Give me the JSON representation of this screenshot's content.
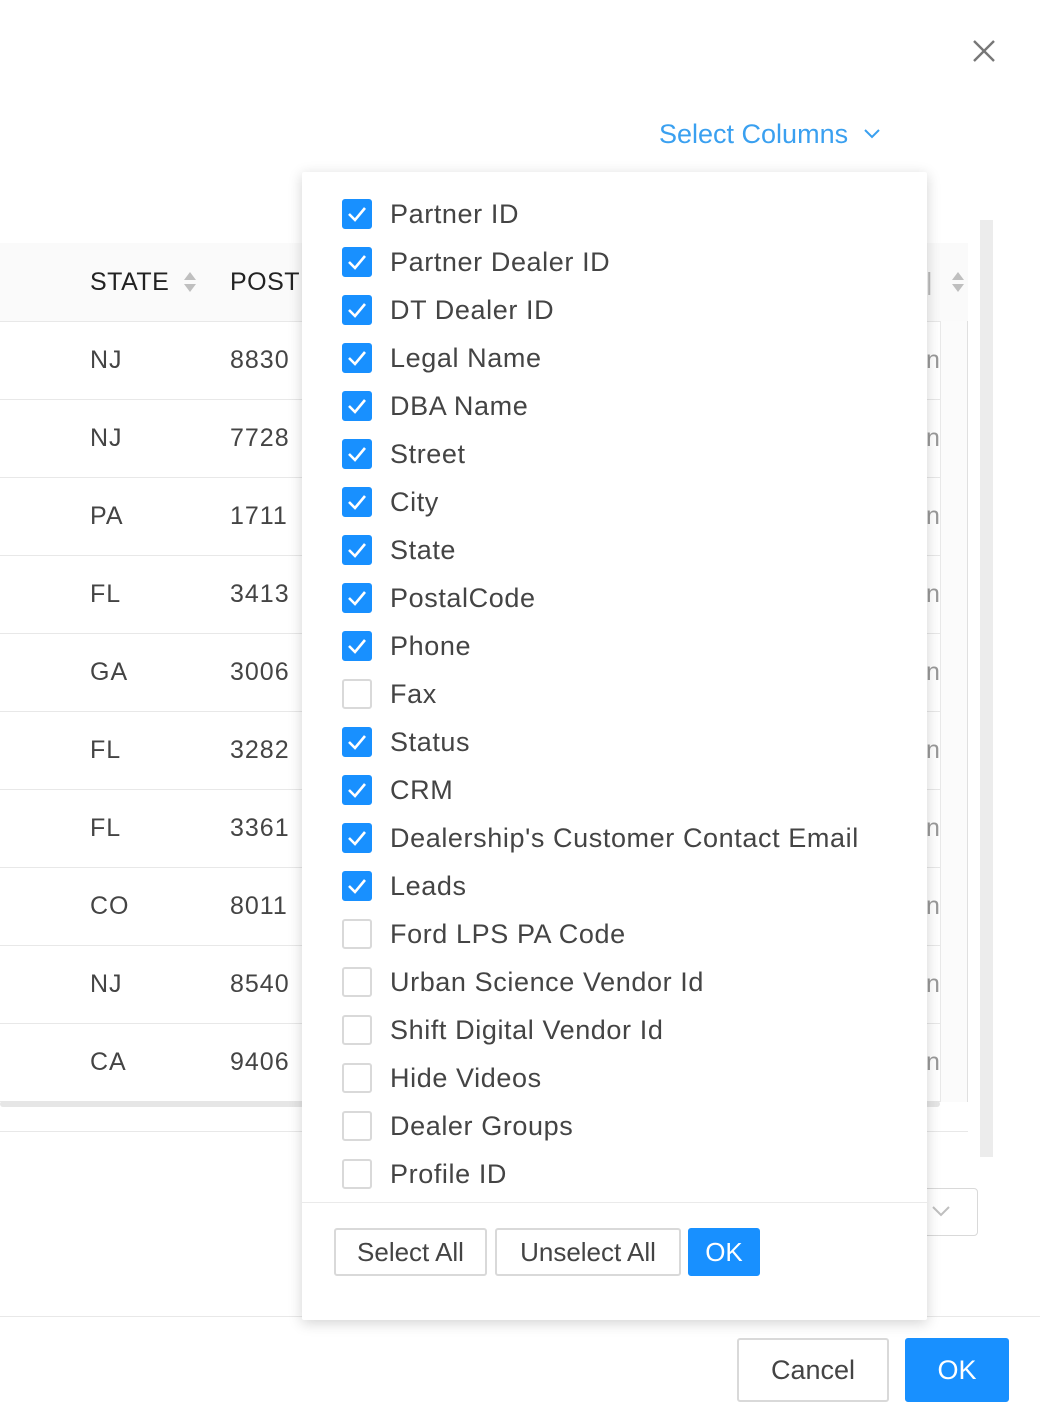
{
  "icons": {
    "close": "close-icon",
    "dropdown_chevron": "chevron-down-icon"
  },
  "header": {
    "select_columns_label": "Select Columns"
  },
  "table": {
    "headers": {
      "state": "STATE",
      "postal": "POST"
    },
    "rows": [
      {
        "state": "NJ",
        "postal": "8830"
      },
      {
        "state": "NJ",
        "postal": "7728"
      },
      {
        "state": "PA",
        "postal": "1711"
      },
      {
        "state": "FL",
        "postal": "3413"
      },
      {
        "state": "GA",
        "postal": "3006"
      },
      {
        "state": "FL",
        "postal": "3282"
      },
      {
        "state": "FL",
        "postal": "3361"
      },
      {
        "state": "CO",
        "postal": "8011"
      },
      {
        "state": "NJ",
        "postal": "8540"
      },
      {
        "state": "CA",
        "postal": "9406"
      }
    ],
    "right_clip_char": "n"
  },
  "column_picker": {
    "options": [
      {
        "label": "Partner ID",
        "checked": true
      },
      {
        "label": "Partner Dealer ID",
        "checked": true
      },
      {
        "label": "DT Dealer ID",
        "checked": true
      },
      {
        "label": "Legal Name",
        "checked": true
      },
      {
        "label": "DBA Name",
        "checked": true
      },
      {
        "label": "Street",
        "checked": true
      },
      {
        "label": "City",
        "checked": true
      },
      {
        "label": "State",
        "checked": true
      },
      {
        "label": "PostalCode",
        "checked": true
      },
      {
        "label": "Phone",
        "checked": true
      },
      {
        "label": "Fax",
        "checked": false
      },
      {
        "label": "Status",
        "checked": true
      },
      {
        "label": "CRM",
        "checked": true
      },
      {
        "label": "Dealership's Customer Contact Email",
        "checked": true
      },
      {
        "label": "Leads",
        "checked": true
      },
      {
        "label": "Ford LPS PA Code",
        "checked": false
      },
      {
        "label": "Urban Science Vendor Id",
        "checked": false
      },
      {
        "label": "Shift Digital Vendor Id",
        "checked": false
      },
      {
        "label": "Hide Videos",
        "checked": false
      },
      {
        "label": "Dealer Groups",
        "checked": false
      },
      {
        "label": "Profile ID",
        "checked": false
      }
    ],
    "select_all_label": "Select All",
    "unselect_all_label": "Unselect All",
    "ok_label": "OK"
  },
  "footer": {
    "cancel_label": "Cancel",
    "ok_label": "OK"
  },
  "colors": {
    "accent": "#1890ff",
    "link": "#3aa0f0"
  }
}
